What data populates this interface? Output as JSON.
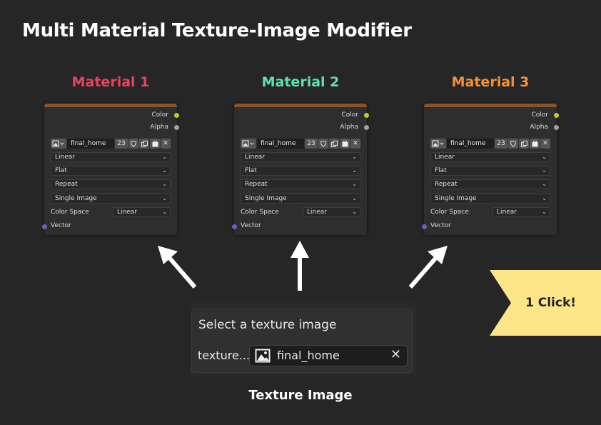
{
  "title": "Multi Material Texture-Image Modifier",
  "materials": [
    {
      "label": "Material 1",
      "color": "#e8435f"
    },
    {
      "label": "Material 2",
      "color": "#5de2a9"
    },
    {
      "label": "Material 3",
      "color": "#f4923a"
    }
  ],
  "node": {
    "outputs": [
      "Color",
      "Alpha"
    ],
    "image_name": "final_home",
    "users": "23",
    "interpolation": "Linear",
    "projection": "Flat",
    "extension": "Repeat",
    "source": "Single Image",
    "color_space_label": "Color Space",
    "color_space": "Linear",
    "input": "Vector"
  },
  "panel": {
    "title": "Select a texture image",
    "label": "texture...",
    "value": "final_home"
  },
  "caption": "Texture Image",
  "badge": "1 Click!",
  "colors": {
    "node_header": "#8a542a",
    "socket_color": "#c7c729",
    "socket_alpha": "#a0a0a0",
    "socket_vector": "#6363c7",
    "badge": "#fde68a"
  }
}
